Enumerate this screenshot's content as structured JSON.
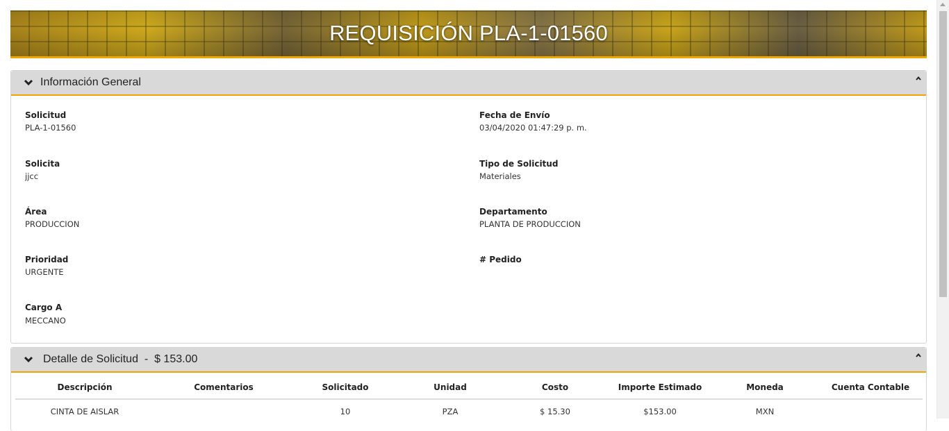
{
  "header": {
    "title": "REQUISICIÓN PLA-1-01560"
  },
  "info_panel": {
    "title": "Información General",
    "fields": [
      {
        "label": "Solicitud",
        "value": "PLA-1-01560"
      },
      {
        "label": "Fecha de Envío",
        "value": "03/04/2020 01:47:29 p. m."
      },
      {
        "label": "Solicita",
        "value": "jjcc"
      },
      {
        "label": "Tipo de Solicitud",
        "value": "Materiales"
      },
      {
        "label": "Área",
        "value": "PRODUCCION"
      },
      {
        "label": "Departamento",
        "value": "PLANTA DE PRODUCCION"
      },
      {
        "label": "Prioridad",
        "value": "URGENTE"
      },
      {
        "label": "# Pedido",
        "value": ""
      },
      {
        "label": "Cargo A",
        "value": "MECCANO"
      }
    ]
  },
  "detail_panel": {
    "title": "Detalle de Solicitud  -  $ 153.00",
    "columns": [
      "Descripción",
      "Comentarios",
      "Solicitado",
      "Unidad",
      "Costo",
      "Importe Estimado",
      "Moneda",
      "Cuenta Contable"
    ],
    "rows": [
      [
        "CINTA DE AISLAR",
        "",
        "10",
        "PZA",
        "$ 15.30",
        "$153.00",
        "MXN",
        ""
      ]
    ]
  },
  "colors": {
    "accent": "#f0a500",
    "panel_header": "#d9d9d9"
  },
  "icons": {
    "expand": "chevron-down-icon",
    "collapse": "caret-up-icon"
  }
}
